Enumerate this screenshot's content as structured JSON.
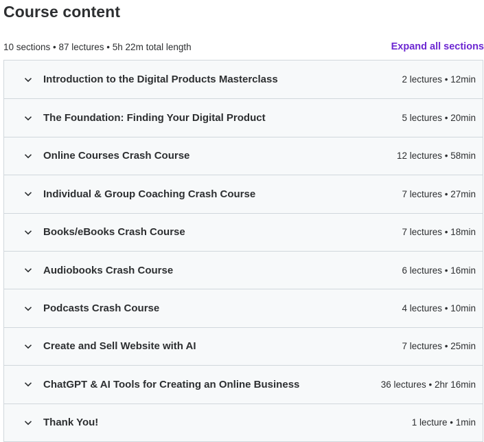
{
  "header": {
    "title": "Course content",
    "summary": "10 sections • 87 lectures • 5h 22m total length",
    "expand_all_label": "Expand all sections"
  },
  "accent_color": "#6d28d2",
  "sections": [
    {
      "title": "Introduction to the Digital Products Masterclass",
      "meta": "2 lectures • 12min"
    },
    {
      "title": "The Foundation: Finding Your Digital Product",
      "meta": "5 lectures • 20min"
    },
    {
      "title": "Online Courses Crash Course",
      "meta": "12 lectures • 58min"
    },
    {
      "title": "Individual & Group Coaching Crash Course",
      "meta": "7 lectures • 27min"
    },
    {
      "title": "Books/eBooks Crash Course",
      "meta": "7 lectures • 18min"
    },
    {
      "title": "Audiobooks Crash Course",
      "meta": "6 lectures • 16min"
    },
    {
      "title": "Podcasts Crash Course",
      "meta": "4 lectures • 10min"
    },
    {
      "title": "Create and Sell Website with AI",
      "meta": "7 lectures • 25min"
    },
    {
      "title": "ChatGPT & AI Tools for Creating an Online Business",
      "meta": "36 lectures • 2hr 16min"
    },
    {
      "title": "Thank You!",
      "meta": "1 lecture • 1min"
    }
  ]
}
